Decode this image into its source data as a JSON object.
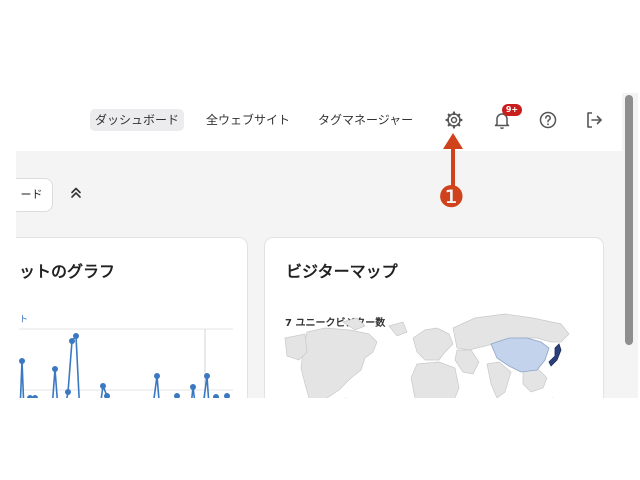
{
  "nav": {
    "items": [
      {
        "label": "ダッシュボード",
        "active": true
      },
      {
        "label": "全ウェブサイト",
        "active": false
      },
      {
        "label": "タグマネージャー",
        "active": false
      }
    ],
    "settings_icon": "gear-icon",
    "notifications_icon": "bell-icon",
    "notification_badge": "9+",
    "help_icon": "question-circle-icon",
    "logout_icon": "logout-icon"
  },
  "toolbar": {
    "dashboard_button_label": "ード",
    "collapse_icon": "double-chevron-up-icon"
  },
  "cards": {
    "graph_title": "ットのグラフ",
    "graph_legend": "ト",
    "map_title": "ビジターマップ",
    "map_caption": "7 ユニークビジター数"
  },
  "annotation": {
    "marker": "❶",
    "color": "#d0421b"
  },
  "colors": {
    "series": "#3b78c2",
    "badge": "#c81e1e",
    "china": "#c3d3ec",
    "japan": "#2b3f7a"
  }
}
